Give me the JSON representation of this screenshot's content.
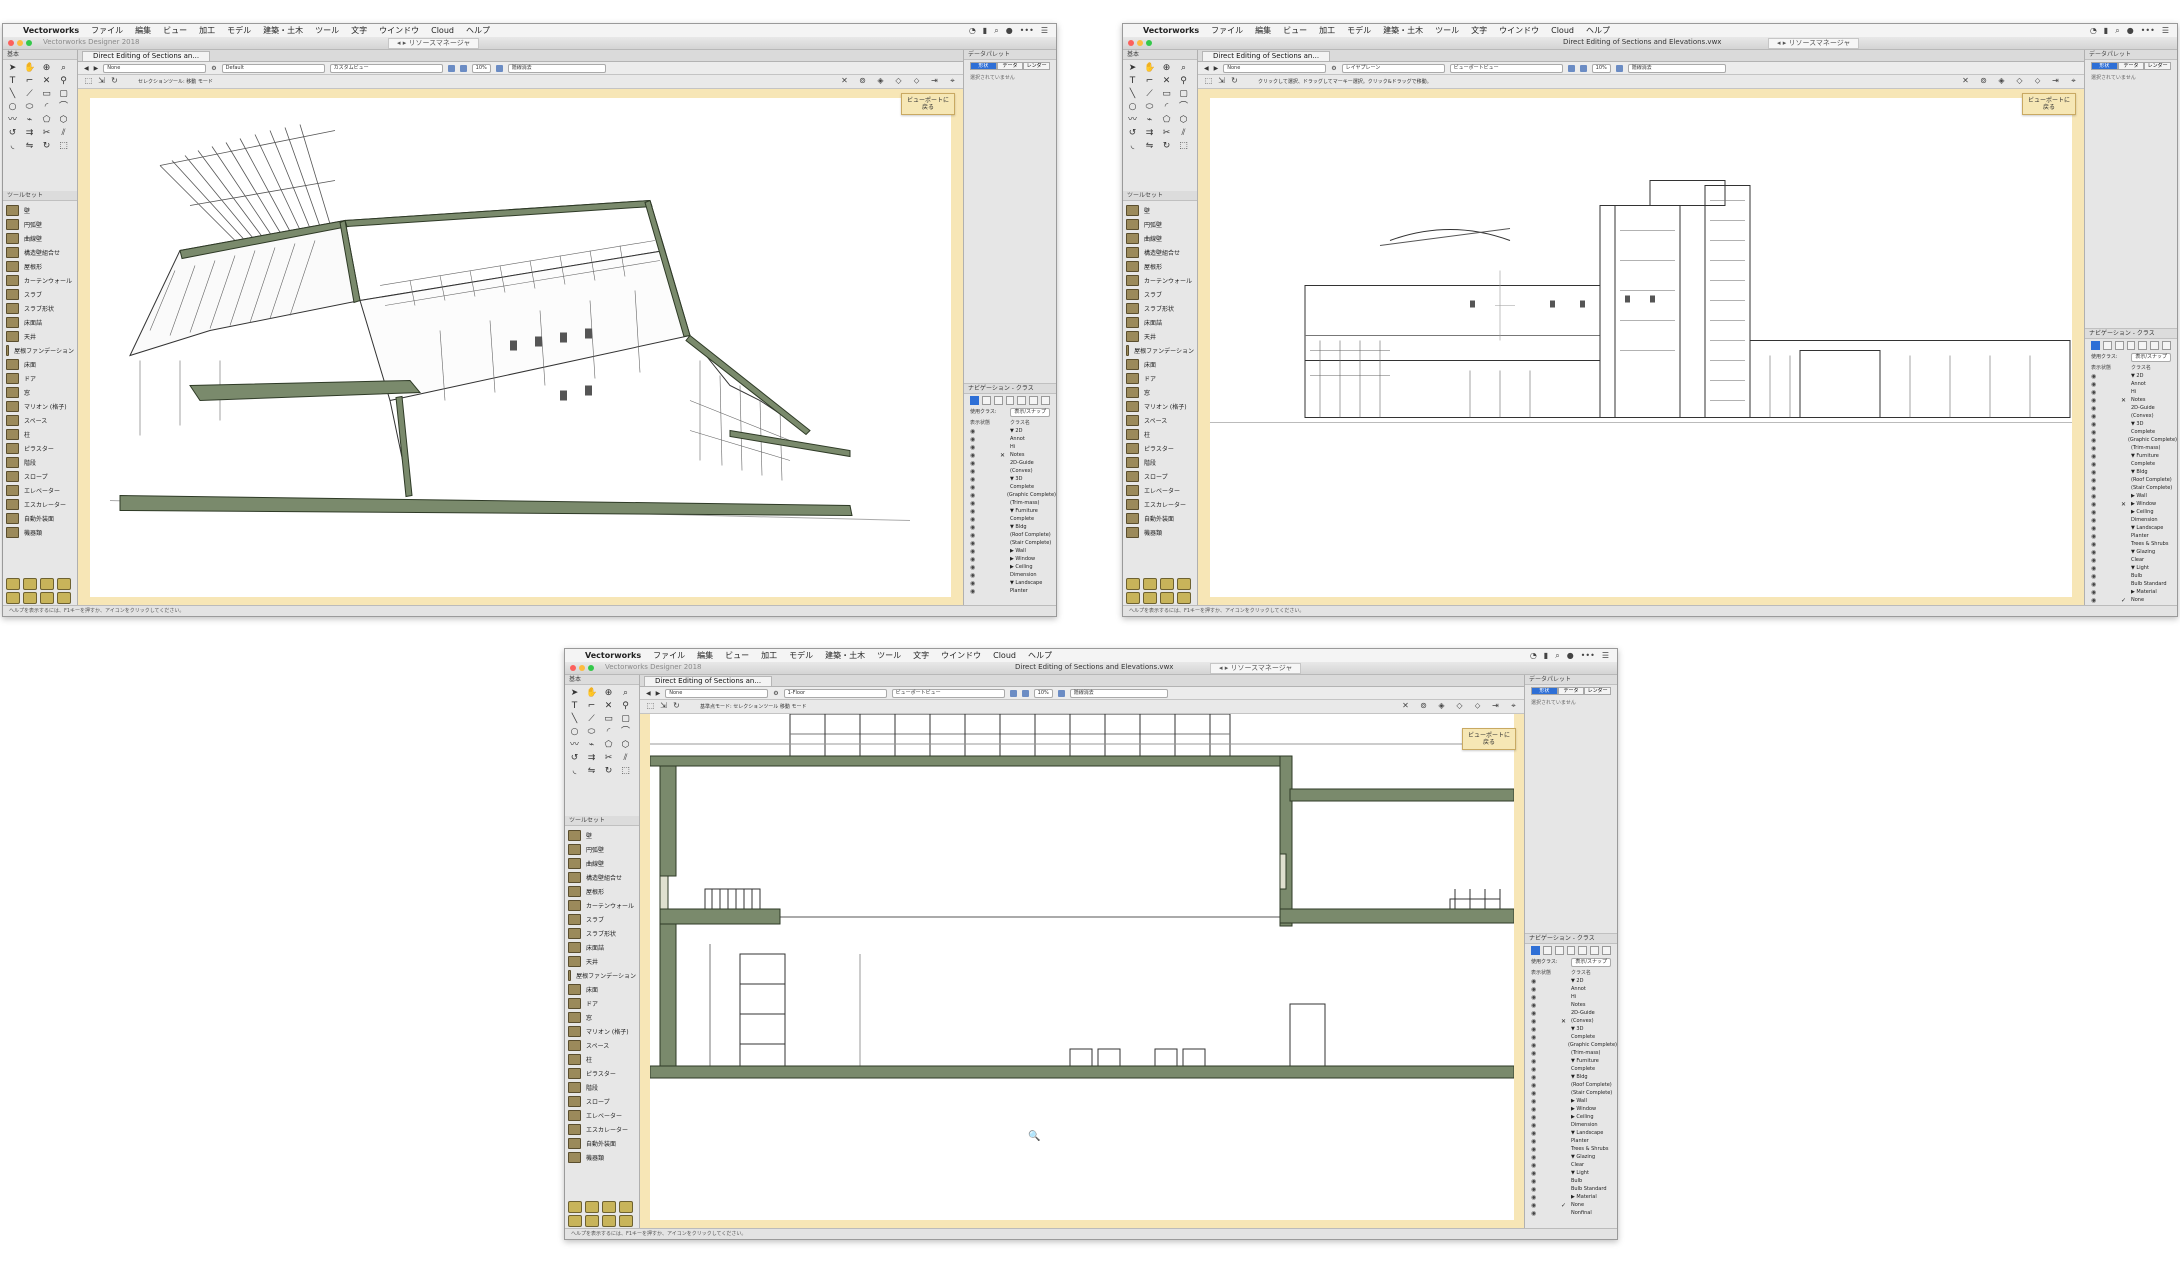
{
  "menu": {
    "app": "Vectorworks",
    "items": [
      "ファイル",
      "編集",
      "ビュー",
      "加工",
      "モデル",
      "建築・土木",
      "ツール",
      "文字",
      "ウインドウ",
      "Cloud",
      "ヘルプ"
    ]
  },
  "app_title": "Vectorworks Designer 2018",
  "document_title": "Direct Editing of Sections and Elevations.vwx",
  "resource_manager": "リソースマネージャ",
  "document_tab": "Direct Editing of Sections an...",
  "left_panel": {
    "basic_title": "基本",
    "toolsets_title": "ツールセット",
    "toolsets": [
      "壁",
      "円弧壁",
      "曲線壁",
      "構造壁組合せ",
      "屋根形",
      "カーテンウォール",
      "スラブ",
      "スラブ形状",
      "床面詰",
      "天井",
      "屋根ファンデーション",
      "床面",
      "ドア",
      "窓",
      "マリオン (格子)",
      "スペース",
      "柱",
      "ピラスター",
      "階段",
      "スロープ",
      "エレベーター",
      "エスカレーター",
      "自動外装面",
      "機器類"
    ]
  },
  "viewbar": {
    "class_field": "None",
    "layer_field_w1": "Default",
    "layer_field_w2": "レイヤプレーン",
    "layer_field_w3": "1-Floor",
    "view_field_w1": "カスタムビュー",
    "view_field_w2": "ビューポートビュー",
    "render_field_w1": "隠線消去",
    "zoom": "10%"
  },
  "modebar": {
    "hint_w1": "セレクションツール: 移動 モード",
    "hint_w2": "クリックして選択、ドラッグしてマーキー選択。クリック&ドラッグで移動。",
    "hint_w3": "基準点モード: セレクションツール 移動 モード"
  },
  "return_button": "ビューポートに\n戻る",
  "status_text": "ヘルプを表示するには、F1キーを押すか、アイコンをクリックしてください。",
  "right_panel": {
    "object_info_title": "データパレット",
    "tabs": [
      "形状",
      "データ",
      "レンダー"
    ],
    "object_info_empty": "選択されていません",
    "nav_title": "ナビゲーション - クラス",
    "active_class_label": "使用クラス:",
    "active_class_value": "表示/スナップ",
    "col_visibility": "表示状態",
    "col_class": "クラス名",
    "classes": [
      "▼ 2D",
      "Annot",
      "Hi",
      "Notes",
      "2D-Guide",
      "(Convex)",
      "▼ 3D",
      "Complete",
      "(Graphic Complete)",
      "(Trim-mass)",
      "▼ Furniture",
      "Complete",
      "▼ Bldg",
      "(Roof Complete)",
      "(Stair Complete)",
      "▶ Wall",
      "▶ Window",
      "▶ Ceiling",
      "Dimension",
      "▼ Landscape",
      "Planter",
      "Trees & Shrubs",
      "▼ Glazing",
      "Clear",
      "▼ Light",
      "Bulb",
      "Bulb Standard",
      "▶ Material",
      "None",
      "Nonfinal"
    ]
  }
}
